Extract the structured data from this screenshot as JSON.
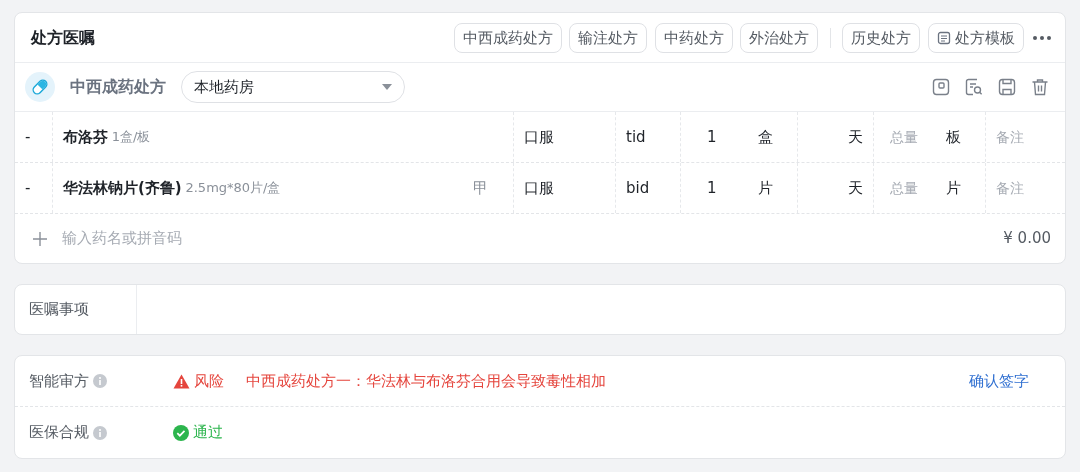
{
  "header": {
    "title": "处方医嘱",
    "prescription_types": [
      "中西成药处方",
      "输注处方",
      "中药处方",
      "外治处方"
    ],
    "history_button": "历史处方",
    "template_button": "处方模板"
  },
  "prescription": {
    "title": "中西成药处方",
    "pharmacy": "本地药房"
  },
  "rows": [
    {
      "remove": "-",
      "name": "布洛芬",
      "spec": "1盒/板",
      "route": "口服",
      "frequency": "tid",
      "dose": "1",
      "dose_unit": "盒",
      "days_unit": "天",
      "total_placeholder": "总量",
      "total_unit": "板",
      "note_placeholder": "备注"
    },
    {
      "remove": "-",
      "name": "华法林钠片(齐鲁)",
      "spec": "2.5mg*80片/盒",
      "insurance": "甲",
      "route": "口服",
      "frequency": "bid",
      "dose": "1",
      "dose_unit": "片",
      "days_unit": "天",
      "total_placeholder": "总量",
      "total_unit": "片",
      "note_placeholder": "备注"
    }
  ],
  "add_row": {
    "placeholder": "输入药名或拼音码",
    "total": "¥ 0.00"
  },
  "notes": {
    "label": "医嘱事项"
  },
  "review": [
    {
      "label": "智能审方",
      "kind": "risk",
      "status": "风险",
      "message": "中西成药处方一：华法林与布洛芬合用会导致毒性相加",
      "action": "确认签字"
    },
    {
      "label": "医保合规",
      "kind": "pass",
      "status": "通过"
    }
  ]
}
